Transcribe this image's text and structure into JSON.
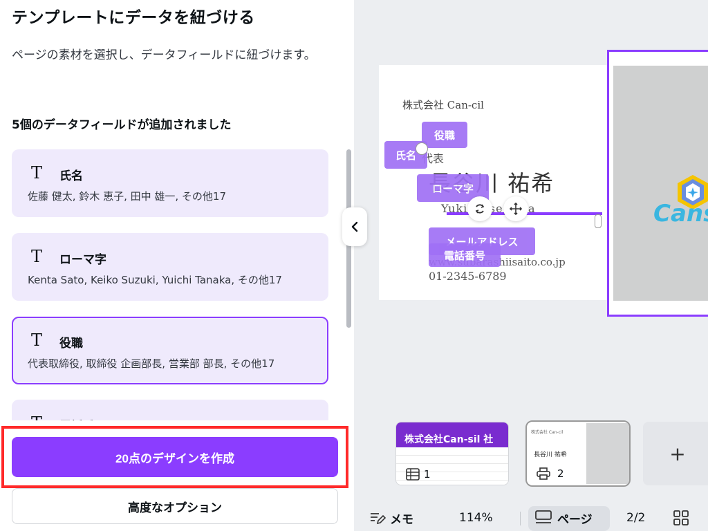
{
  "panel": {
    "title": "テンプレートにデータを紐づける",
    "description": "ページの素材を選択し、データフィールドに紐づけます。",
    "field_count_text": "5個のデータフィールドが追加されました",
    "fields": [
      {
        "icon": "text-icon",
        "name": "氏名",
        "values": "佐藤 健太, 鈴木 恵子, 田中 雄一, その他17"
      },
      {
        "icon": "text-icon",
        "name": "ローマ字",
        "values": "Kenta Sato, Keiko Suzuki, Yuichi Tanaka, その他17"
      },
      {
        "icon": "text-icon",
        "name": "役職",
        "values": "代表取締役, 取締役 企画部長, 営業部 部長, その他17",
        "selected": true
      },
      {
        "icon": "text-icon",
        "name": "電話番号",
        "values": ""
      }
    ],
    "create_button": "20点のデザインを作成",
    "advanced_button": "高度なオプション",
    "collapse_icon": "chevron-left-icon"
  },
  "canvas": {
    "card": {
      "company": "株式会社 Can-cil",
      "title": "代表",
      "name": "長谷川 祐希",
      "roma": "Yuki Hasegawa",
      "url": "www.subarashiisaito.co.jp",
      "phone": "01-2345-6789"
    },
    "tags": {
      "title_tag": "役職",
      "name_tag": "氏名",
      "roma_tag": "ローマ字",
      "email_tag": "メールアドレス",
      "phone_tag": "電話番号"
    },
    "logo_text": "Cans"
  },
  "thumbnails": [
    {
      "header": "株式会社Can-sil 社",
      "number": "1",
      "icon": "table-icon"
    },
    {
      "company": "株式会社 Can-cil",
      "name": "長谷川 祐希",
      "number": "2",
      "icon": "print-icon"
    }
  ],
  "add_page_icon": "plus-icon",
  "footer": {
    "notes_label": "メモ",
    "zoom": "114%",
    "pages_label": "ページ",
    "page_count": "2/2"
  },
  "colors": {
    "accent": "#8b3dff",
    "field_bg": "#efeafc",
    "highlight": "#ff2a2a"
  }
}
